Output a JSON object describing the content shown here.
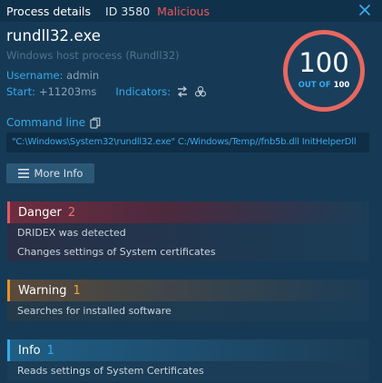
{
  "header": {
    "title": "Process details",
    "id_label": "ID 3580",
    "verdict": "Malicious",
    "close_icon": "close-icon"
  },
  "process": {
    "name": "rundll32.exe",
    "description": "Windows host process (Rundll32)",
    "username_label": "Username:",
    "username": "admin",
    "start_label": "Start:",
    "start": "+11203ms",
    "indicators_label": "Indicators:",
    "indicator_icons": [
      "network-connections-icon",
      "biohazard-icon"
    ]
  },
  "score": {
    "value": "100",
    "out_of_label": "OUT OF",
    "max": "100",
    "ring_color": "#e8675f"
  },
  "command": {
    "label": "Command line",
    "text": "\"C:\\Windows\\System32\\rundll32.exe\" C:/Windows/Temp//fnb5b.dll InitHelperDll"
  },
  "more_info_button": "More Info",
  "sections": {
    "danger": {
      "title": "Danger",
      "count": "2",
      "color": "#e35a63",
      "items": [
        "DRIDEX was detected",
        "Changes settings of System certificates"
      ]
    },
    "warning": {
      "title": "Warning",
      "count": "1",
      "color": "#e59526",
      "items": [
        "Searches for installed software"
      ]
    },
    "info": {
      "title": "Info",
      "count": "1",
      "color": "#37a9ec",
      "items": [
        "Reads settings of System Certificates"
      ]
    }
  },
  "colors": {
    "background": "#163a55",
    "accent": "#37a9ec",
    "malicious": "#ee5757"
  }
}
